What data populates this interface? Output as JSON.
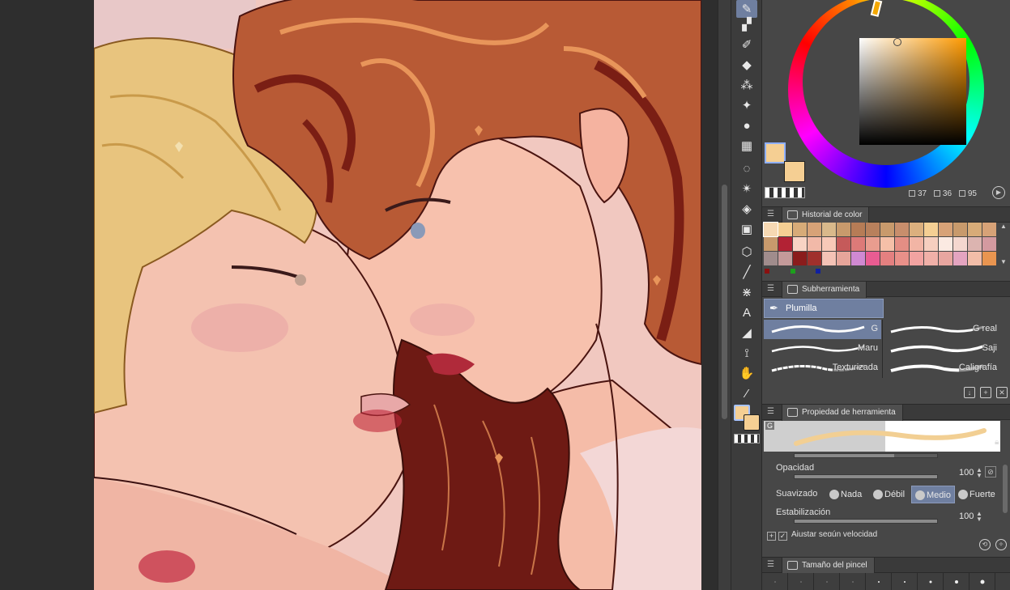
{
  "color_panel": {
    "hue_readout": "37",
    "saturation_readout": "36",
    "value_readout": "95",
    "main_color": "#f5cf93",
    "sub_color": "#f5cf93"
  },
  "color_history": {
    "title": "Historial de color",
    "rows": [
      [
        "#f7d9b3",
        "#f5cf93",
        "#d7ab78",
        "#d7a277",
        "#d9b98b",
        "#c89a6c",
        "#b67c56",
        "#b8805c",
        "#c89a6c",
        "#c88e6c",
        "#dcb07e",
        "#f5cf93",
        "#d7a277",
        "#c89a6c",
        "#d7ab78",
        "#d7a277"
      ],
      [
        "#c89a6c",
        "#b22234",
        "#f8d3c4",
        "#f2b9a8",
        "#f8c9b8",
        "#c55a5a",
        "#dd7a78",
        "#e99d8f",
        "#f5c0a8",
        "#e48e84",
        "#f2b5a5",
        "#f6cfbf",
        "#fbeae2",
        "#f4d7cf",
        "#dcb4b0",
        "#d49aa0"
      ],
      [
        "#a08c8c",
        "#c49a9a",
        "#8a1c1c",
        "#a0302c",
        "#f4c3b6",
        "#e6a59a",
        "#d089d2",
        "#e95c92",
        "#e48080",
        "#e99089",
        "#f2a3a1",
        "#f0b0a8",
        "#e8a6a0",
        "#e4a4c0",
        "#f2bda8",
        "#e99550"
      ]
    ],
    "mini": [
      "#8a1010",
      "#1ca01c",
      "#1020a0"
    ]
  },
  "subtool": {
    "title": "Subherramienta",
    "group": "Plumilla",
    "brushes": [
      {
        "label": "G",
        "selected": true
      },
      {
        "label": "G real",
        "selected": false
      },
      {
        "label": "Maru",
        "selected": false
      },
      {
        "label": "Saji",
        "selected": false
      },
      {
        "label": "Texturizada",
        "selected": false
      },
      {
        "label": "Caligrafía",
        "selected": false
      }
    ]
  },
  "tool_property": {
    "title": "Propiedad de herramienta",
    "preview_tag": "G",
    "opacity_label": "Opacidad",
    "opacity_value": "100",
    "opacity_fraction": 1.0,
    "smoothing_label": "Suavizado",
    "smoothing_options": [
      "Nada",
      "Débil",
      "Medio",
      "Fuerte"
    ],
    "smoothing_selected": "Medio",
    "stabilization_label": "Estabilización",
    "stabilization_value": "100",
    "stabilization_fraction": 1.0,
    "speed_label": "Ajustar según velocidad"
  },
  "brush_size": {
    "title": "Tamaño del pincel"
  },
  "tools": [
    "pen-icon",
    "marker-icon",
    "brush-icon",
    "eraser-icon",
    "airbrush-icon",
    "sparkle-icon",
    "blend-icon",
    "grid-icon",
    "lasso-icon",
    "magic-wand-icon",
    "fill-icon",
    "gradient-icon",
    "3d-object-icon",
    "line-icon",
    "pattern-icon",
    "text-icon",
    "balloon-icon",
    "ruler-icon",
    "hand-icon",
    "eyedropper-icon"
  ]
}
